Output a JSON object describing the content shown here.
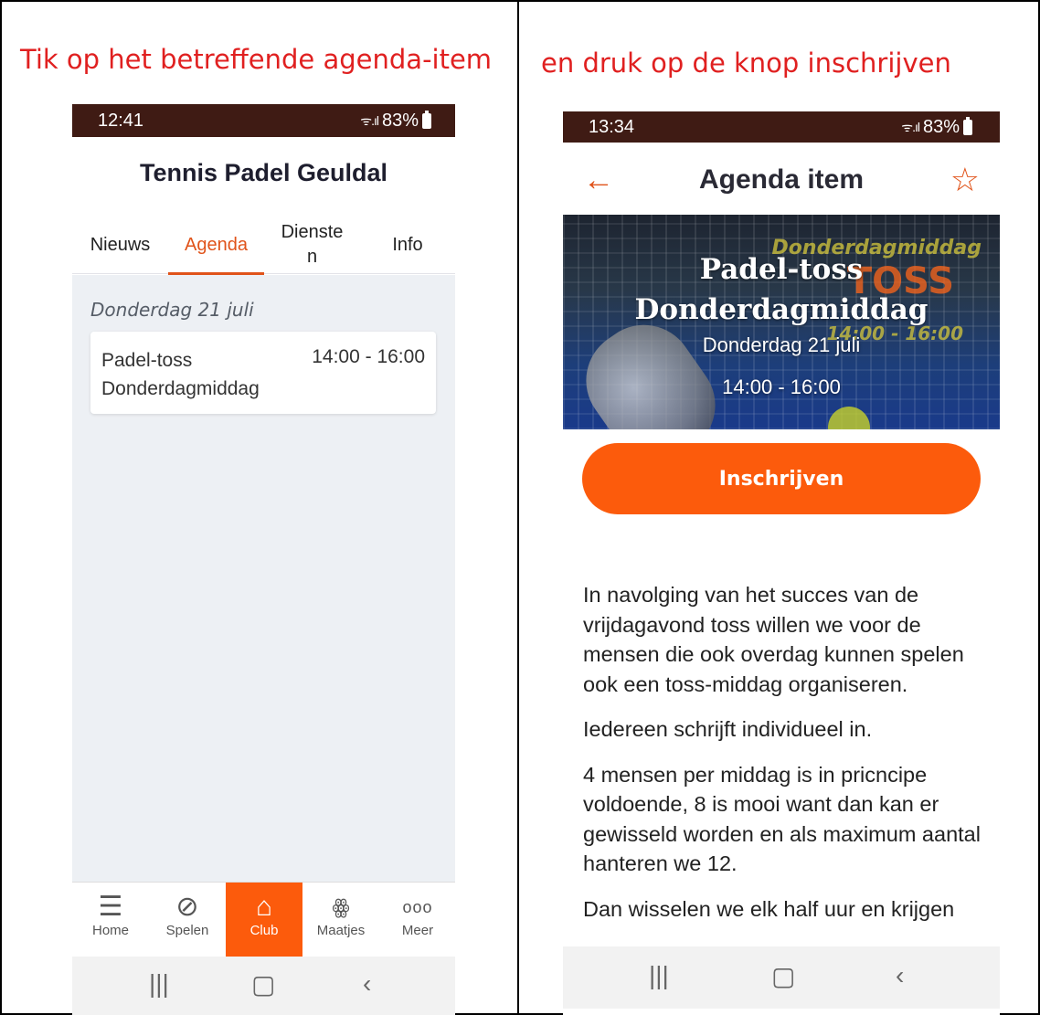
{
  "captions": {
    "left": "Tik op het betreffende agenda-item",
    "right": "en druk op de knop inschrijven"
  },
  "phone1": {
    "status": {
      "time": "12:41",
      "battery": "83%"
    },
    "title": "Tennis Padel Geuldal",
    "tabs": [
      {
        "label": "Nieuws"
      },
      {
        "label": "Agenda",
        "active": true
      },
      {
        "label": "Dienste\nn"
      },
      {
        "label": "Info"
      }
    ],
    "date_heading": "Donderdag 21 juli",
    "event": {
      "title": "Padel-toss Donderdagmiddag",
      "time": "14:00 - 16:00"
    },
    "bottom_nav": [
      {
        "label": "Home",
        "icon": "menu-icon"
      },
      {
        "label": "Spelen",
        "icon": "tennis-ball-icon"
      },
      {
        "label": "Club",
        "icon": "home-icon",
        "active": true
      },
      {
        "label": "Maatjes",
        "icon": "people-icon"
      },
      {
        "label": "Meer",
        "icon": "more-icon"
      }
    ]
  },
  "phone2": {
    "status": {
      "time": "13:34",
      "battery": "83%"
    },
    "title": "Agenda item",
    "hero": {
      "title_line1": "Padel-toss",
      "title_line2": "Donderdagmiddag",
      "date": "Donderdag 21 juli",
      "time": "14:00 - 16:00",
      "watermark1": "Donderdagmiddag",
      "watermark2": "TOSS",
      "watermark3": "14:00 - 16:00"
    },
    "button_label": "Inschrijven",
    "description": [
      "In navolging van het succes van de vrijdagavond toss willen we voor de mensen die ook overdag kunnen spelen ook een toss-middag organiseren.",
      "Iedereen schrijft individueel in.",
      "4 mensen per middag is in pricncipe voldoende, 8 is mooi want dan kan er gewisseld worden en als maximum aantal hanteren we 12.",
      "Dan wisselen we elk half uur en krijgen"
    ]
  },
  "colors": {
    "accent": "#fc5b0c",
    "status_bar": "#3f1b14",
    "caption": "#e02020"
  }
}
